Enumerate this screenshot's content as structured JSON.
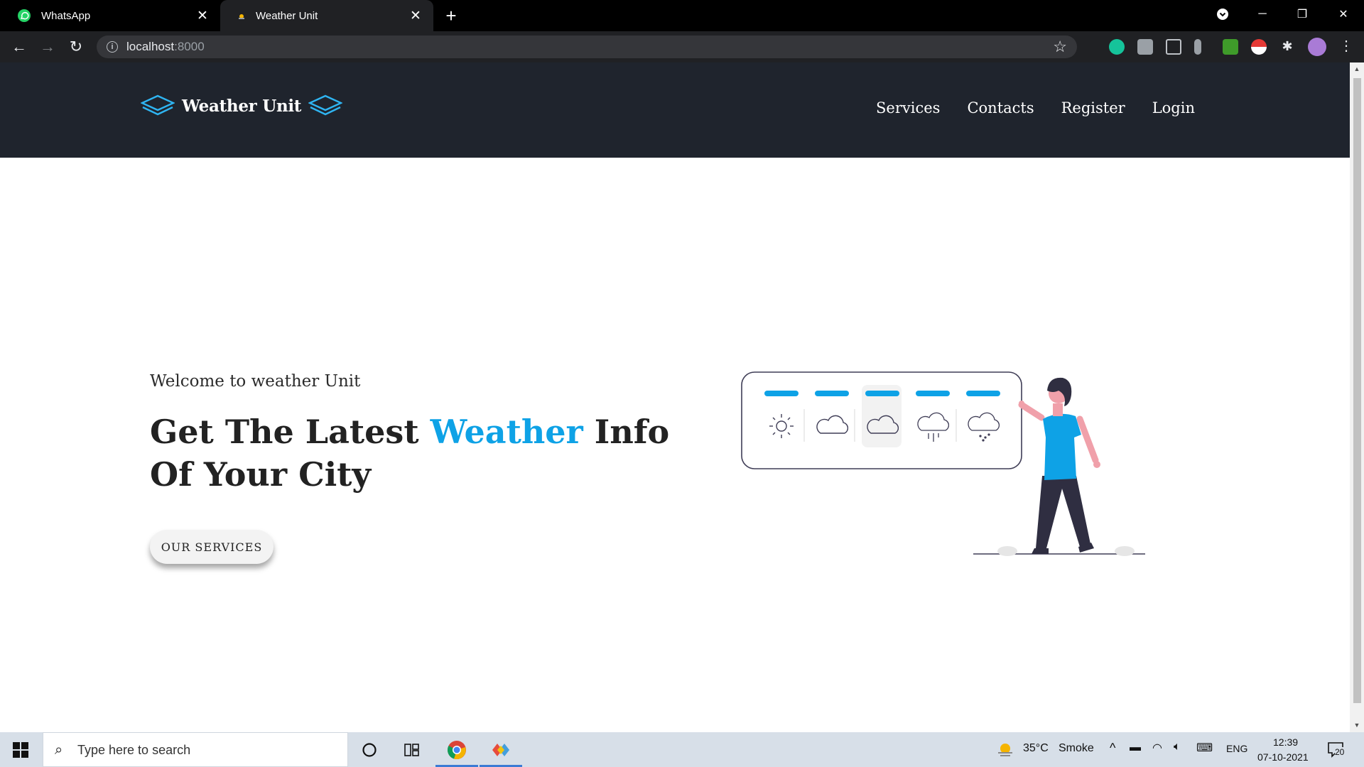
{
  "browser": {
    "tabs": [
      {
        "title": "WhatsApp",
        "icon": "whatsapp-icon",
        "active": false
      },
      {
        "title": "Weather Unit",
        "icon": "site-favicon",
        "active": true
      }
    ],
    "url_host": "localhost",
    "url_port": ":8000"
  },
  "site": {
    "logo_text": "Weather Unit",
    "nav": [
      "Services",
      "Contacts",
      "Register",
      "Login"
    ]
  },
  "hero": {
    "subtitle": "Welcome to weather Unit",
    "title_before": "Get The Latest ",
    "title_accent": "Weather",
    "title_after": " Info Of Your City",
    "button_label": "OUR SERVICES",
    "accent_color": "#0ea2e6"
  },
  "illustration": {
    "weather_icons": [
      "sun-icon",
      "cloud-icon",
      "cloud-icon",
      "rain-icon",
      "snow-icon"
    ]
  },
  "taskbar": {
    "search_placeholder": "Type here to search",
    "weather_temp": "35°C",
    "weather_desc": "Smoke",
    "language": "ENG",
    "time": "12:39",
    "date": "07-10-2021",
    "notification_count": "20"
  }
}
